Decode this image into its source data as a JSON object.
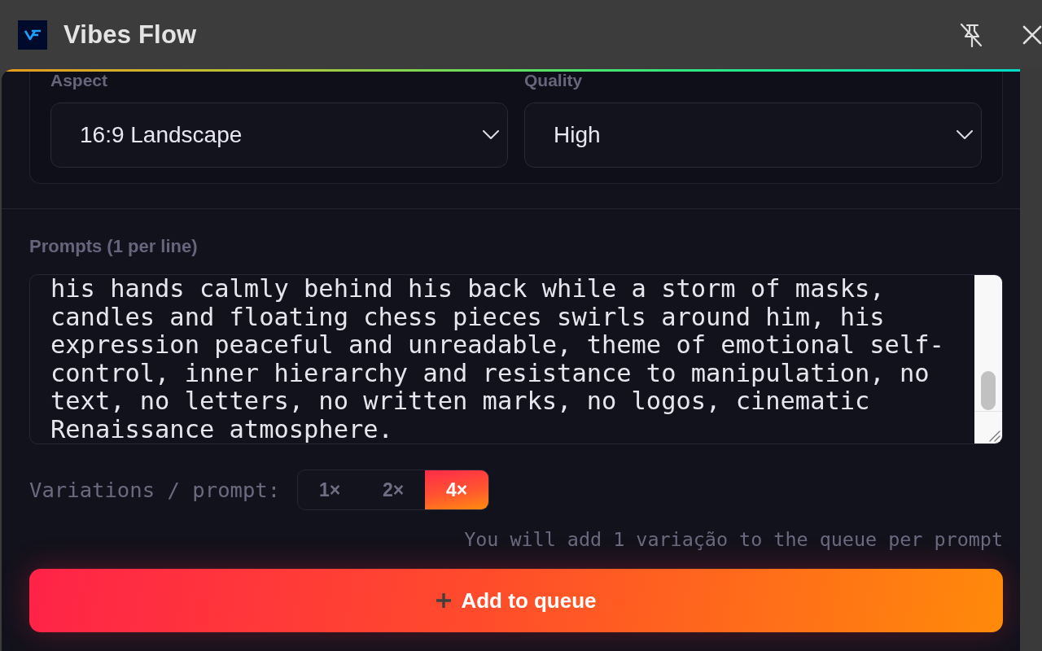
{
  "window": {
    "title": "Vibes Flow"
  },
  "settings": {
    "fields": [
      {
        "label": "Aspect",
        "value": "16:9 Landscape"
      },
      {
        "label": "Quality",
        "value": "High"
      }
    ]
  },
  "prompts": {
    "label": "Prompts (1 per line)",
    "value": "his hands calmly behind his back while a storm of masks, candles and floating chess pieces swirls around him, his expression peaceful and unreadable, theme of emotional self-control, inner hierarchy and resistance to manipulation, no text, no letters, no written marks, no logos, cinematic Renaissance atmosphere."
  },
  "variations": {
    "label": "Variations / prompt:",
    "options": [
      {
        "label": "1×",
        "selected": false
      },
      {
        "label": "2×",
        "selected": false
      },
      {
        "label": "4×",
        "selected": true
      }
    ]
  },
  "summary": "You will add 1 variação to the queue per prompt",
  "add_button": {
    "label": "Add to queue"
  }
}
